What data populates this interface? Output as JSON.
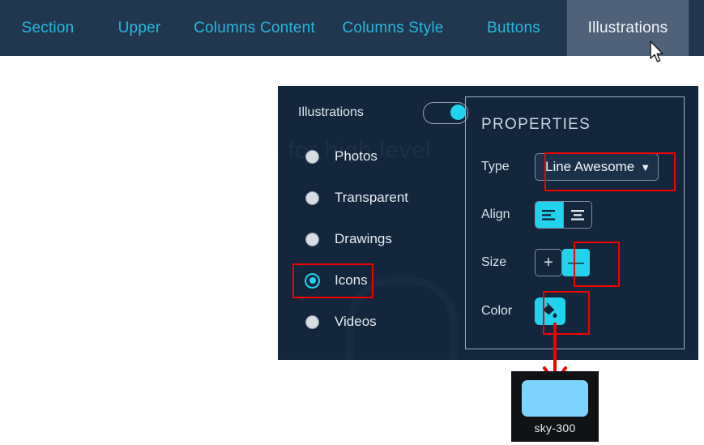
{
  "tabs": [
    {
      "id": "section",
      "label": "Section",
      "active": false
    },
    {
      "id": "upper",
      "label": "Upper",
      "active": false
    },
    {
      "id": "columns-content",
      "label": "Columns Content",
      "active": false
    },
    {
      "id": "columns-style",
      "label": "Columns Style",
      "active": false
    },
    {
      "id": "buttons",
      "label": "Buttons",
      "active": false
    },
    {
      "id": "illustrations",
      "label": "Illustrations",
      "active": true
    }
  ],
  "panel": {
    "watermark_text": "s for high level",
    "watermark_icon": "lightbulb-icon",
    "toggle": {
      "label": "Illustrations",
      "state": "on"
    },
    "radio_group": {
      "selected": "Icons",
      "options": [
        {
          "label": "Photos",
          "selected": false,
          "highlighted": false
        },
        {
          "label": "Transparent",
          "selected": false,
          "highlighted": false
        },
        {
          "label": "Drawings",
          "selected": false,
          "highlighted": false
        },
        {
          "label": "Icons",
          "selected": true,
          "highlighted": true
        },
        {
          "label": "Videos",
          "selected": false,
          "highlighted": false
        }
      ]
    }
  },
  "properties": {
    "title": "PROPERTIES",
    "type": {
      "label": "Type",
      "value": "Line Awesome",
      "chevron": "⌄",
      "highlighted": true
    },
    "align": {
      "label": "Align",
      "selected": "align-left",
      "buttons": [
        {
          "icon": "align-left-icon",
          "active": true
        },
        {
          "icon": "align-center-icon",
          "active": false
        }
      ]
    },
    "size": {
      "label": "Size",
      "buttons": [
        {
          "icon": "plus-icon",
          "glyph": "+",
          "active": false,
          "highlighted": false
        },
        {
          "icon": "minus-icon",
          "glyph": "—",
          "active": true,
          "highlighted": true
        }
      ]
    },
    "color": {
      "label": "Color",
      "icon": "paint-bucket-icon",
      "highlighted": true
    }
  },
  "swatch_tooltip": {
    "name": "sky-300",
    "color": "#7dd3fc"
  },
  "colors": {
    "tabbar_bg": "#21374f",
    "tab_text": "#29b7de",
    "tab_active_bg": "#50617a",
    "panel_bg": "#13263c",
    "accent_cyan": "#22d3ee",
    "highlight_red": "#f40000",
    "swatch": "#7dd3fc"
  }
}
